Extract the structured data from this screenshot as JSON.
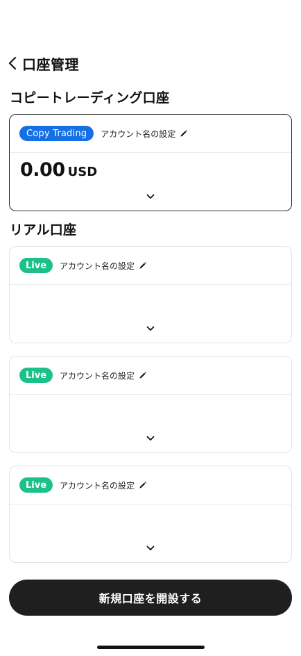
{
  "header": {
    "title": "口座管理"
  },
  "sections": {
    "copy_title": "コピートレーディング口座",
    "real_title": "リアル口座"
  },
  "copy_account": {
    "badge": "Copy Trading",
    "name": "アカウント名の設定",
    "balance": "0.00",
    "currency": "USD"
  },
  "live_accounts": [
    {
      "badge": "Live",
      "name": "アカウント名の設定"
    },
    {
      "badge": "Live",
      "name": "アカウント名の設定"
    },
    {
      "badge": "Live",
      "name": "アカウント名の設定"
    }
  ],
  "cta": {
    "label": "新規口座を開設する"
  },
  "colors": {
    "copy_badge": "#1570e6",
    "live_badge": "#1dc08a",
    "cta_background": "#1f1f1f"
  },
  "icons": [
    "back-chevron-icon",
    "pencil-icon",
    "chevron-down-icon"
  ]
}
